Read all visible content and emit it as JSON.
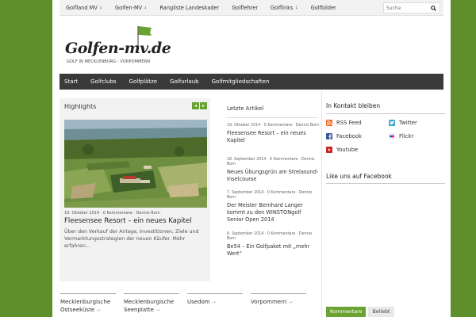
{
  "topnav": {
    "items": [
      {
        "label": "Golfland MV",
        "arrow": "↓"
      },
      {
        "label": "Golfen-MV",
        "arrow": "↓"
      },
      {
        "label": "Rangliste Landeskader",
        "arrow": ""
      },
      {
        "label": "Golflehrer",
        "arrow": ""
      },
      {
        "label": "Golflinks",
        "arrow": "↓"
      },
      {
        "label": "Golfbilder",
        "arrow": ""
      }
    ],
    "search_placeholder": "Suche",
    "search_icon": "search-icon"
  },
  "logo": {
    "text": "Golfen-mv.de",
    "subtitle": "GOLF IN MECKLENBURG - VORPOMMERN",
    "flag_color": "#6aa332"
  },
  "mainnav": {
    "items": [
      "Start",
      "Golfclubs",
      "Golfplätze",
      "Golfurlaub",
      "Golfmitgliedschaften"
    ]
  },
  "highlights": {
    "title": "Highlights",
    "prev": "◂",
    "next": "▸",
    "meta": "19. Oktober 2014 · 0 Kommentare · Dennis Born",
    "headline": "Fleesensee Resort – ein neues Kapitel",
    "excerpt": "Über den Verkauf der Anlage, Investitionen, Ziele und Vermarktungsstrategien der neuen Käufer. Mehr erfahren..."
  },
  "letzte": {
    "title": "Letzte Artikel",
    "articles": [
      {
        "meta": "19. Oktober 2014 · 0 Kommentare · Dennis Born",
        "title": "Fleesensee Resort – ein neues Kapitel"
      },
      {
        "meta": "18. September 2014 · 0 Kommentare · Dennis Born",
        "title": "Neues Übungsgrün am Strelasund-Inselcourse"
      },
      {
        "meta": "7. September 2014 · 0 Kommentare · Dennis Born",
        "title": "Der Meister Bernhard Langer kommt zu den WINSTONgolf Senior Open 2014"
      },
      {
        "meta": "6. September 2014 · 0 Kommentare · Dennis Born",
        "title": "Be54 – Ein Golfpaket mit „mehr Wert“"
      }
    ]
  },
  "contact": {
    "title": "In Kontakt bleiben",
    "links": [
      {
        "label": "RSS Feed",
        "icon": "rss-icon",
        "color": "#f26522"
      },
      {
        "label": "Twitter",
        "icon": "twitter-icon",
        "color": "#3fa9d6"
      },
      {
        "label": "Facebook",
        "icon": "facebook-icon",
        "color": "#3b5998"
      },
      {
        "label": "Flickr",
        "icon": "flickr-icon",
        "color": "#ff0084"
      },
      {
        "label": "Youtube",
        "icon": "youtube-icon",
        "color": "#cc2222"
      }
    ]
  },
  "fb_like": {
    "title": "Like uns auf Facebook"
  },
  "bottom_tabs": {
    "active": "Kommentare",
    "inactive": "Beliebt"
  },
  "regions": [
    {
      "label": "Mecklenburgische Ostseeküste",
      "arrow": "→"
    },
    {
      "label": "Mecklenburgische Seenplatte",
      "arrow": "→"
    },
    {
      "label": "Usedom",
      "arrow": "→"
    },
    {
      "label": "Vorpommern",
      "arrow": "→"
    }
  ],
  "colors": {
    "accent": "#6aa332",
    "background": "#5f8f2b",
    "nav": "#3a3a3a"
  }
}
